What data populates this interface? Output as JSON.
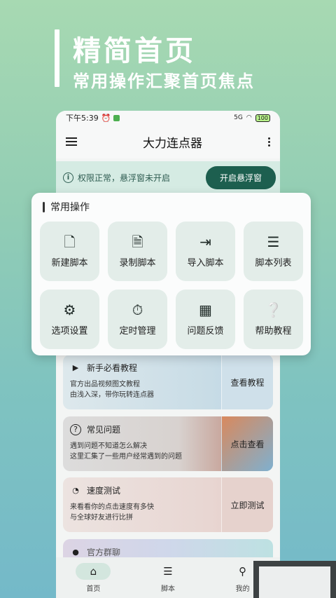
{
  "promo": {
    "title": "精简首页",
    "subtitle": "常用操作汇聚首页焦点"
  },
  "statusbar": {
    "time": "下午5:39",
    "signal": "5G",
    "battery": "100"
  },
  "appbar": {
    "title": "大力连点器"
  },
  "permission": {
    "text": "权限正常，悬浮窗未开启",
    "button": "开启悬浮窗"
  },
  "ops": {
    "title": "常用操作",
    "items": [
      {
        "label": "新建脚本",
        "icon": "new-script-icon",
        "glyph": "🗋"
      },
      {
        "label": "录制脚本",
        "icon": "record-script-icon",
        "glyph": "🗎"
      },
      {
        "label": "导入脚本",
        "icon": "import-script-icon",
        "glyph": "⇥"
      },
      {
        "label": "脚本列表",
        "icon": "list-icon",
        "glyph": "☰"
      },
      {
        "label": "选项设置",
        "icon": "gear-icon",
        "glyph": "⚙"
      },
      {
        "label": "定时管理",
        "icon": "timer-icon",
        "glyph": "⏱"
      },
      {
        "label": "问题反馈",
        "icon": "calendar-icon",
        "glyph": "▦"
      },
      {
        "label": "帮助教程",
        "icon": "help-icon",
        "glyph": "❔"
      }
    ]
  },
  "features": [
    {
      "title": "新手必看教程",
      "desc1": "官方出品视频图文教程",
      "desc2": "由浅入深，带你玩转连点器",
      "action": "查看教程",
      "icon": "play-icon",
      "glyph": "▶"
    },
    {
      "title": "常见问题",
      "desc1": "遇到问题不知道怎么解决",
      "desc2": "这里汇集了一些用户经常遇到的问题",
      "action": "点击查看",
      "icon": "question-icon",
      "glyph": "?"
    },
    {
      "title": "速度测试",
      "desc1": "来看看你的点击速度有多快",
      "desc2": "与全球好友进行比拼",
      "action": "立即测试",
      "icon": "speedometer-icon",
      "glyph": "◔"
    },
    {
      "title": "官方群聊",
      "icon": "chat-icon",
      "glyph": "●"
    }
  ],
  "nav": [
    {
      "label": "首页",
      "icon": "home-icon",
      "glyph": "⌂"
    },
    {
      "label": "脚本",
      "icon": "list-icon",
      "glyph": "☰"
    },
    {
      "label": "我的",
      "icon": "person-icon",
      "glyph": "⚲"
    }
  ]
}
